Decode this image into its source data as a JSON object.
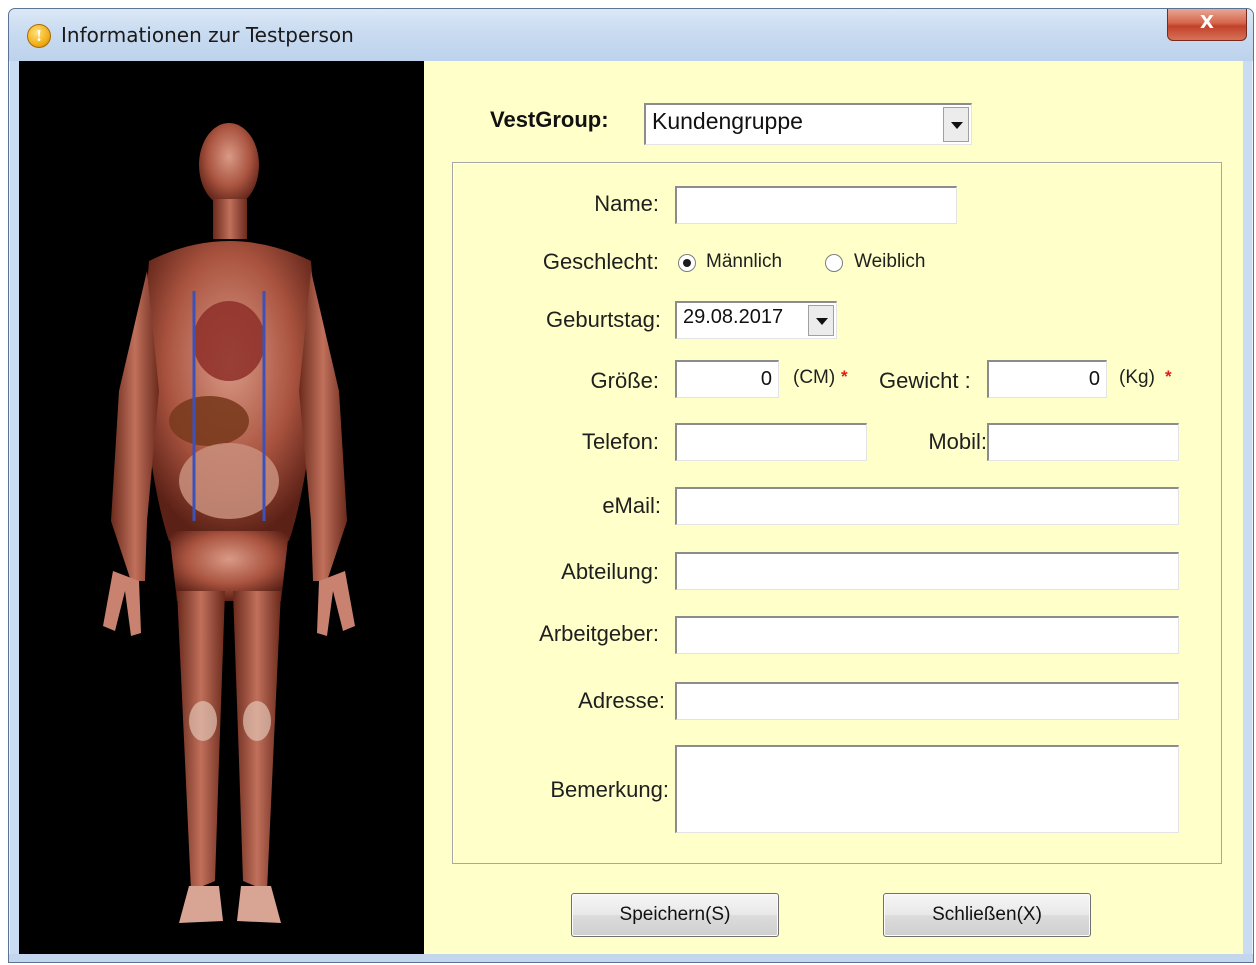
{
  "window": {
    "title": "Informationen zur Testperson",
    "close_label": "X"
  },
  "form": {
    "vestgroup_label": "VestGroup:",
    "vestgroup_value": "Kundengruppe",
    "name_label": "Name:",
    "name_value": "",
    "gender_label": "Geschlecht:",
    "gender_options": [
      "Männlich",
      "Weiblich"
    ],
    "gender_selected": "Männlich",
    "birthday_label": "Geburtstag:",
    "birthday_value": "29.08.2017",
    "height_label": "Größe:",
    "height_value": "0",
    "height_unit": "(CM)",
    "weight_label": "Gewicht :",
    "weight_value": "0",
    "weight_unit": "(Kg)",
    "required_mark": "*",
    "phone_label": "Telefon:",
    "phone_value": "",
    "mobile_label": "Mobil:",
    "mobile_value": "",
    "email_label": "eMail:",
    "email_value": "",
    "department_label": "Abteilung:",
    "department_value": "",
    "employer_label": "Arbeitgeber:",
    "employer_value": "",
    "address_label": "Adresse:",
    "address_value": "",
    "remark_label": "Bemerkung:",
    "remark_value": ""
  },
  "buttons": {
    "save": "Speichern(S)",
    "close": "Schließen(X)"
  },
  "colors": {
    "form_background": "#ffffc9",
    "image_background": "#000000",
    "required": "#e01b1b"
  },
  "icons": [
    "info-icon",
    "close-icon",
    "dropdown-arrow-icon"
  ]
}
